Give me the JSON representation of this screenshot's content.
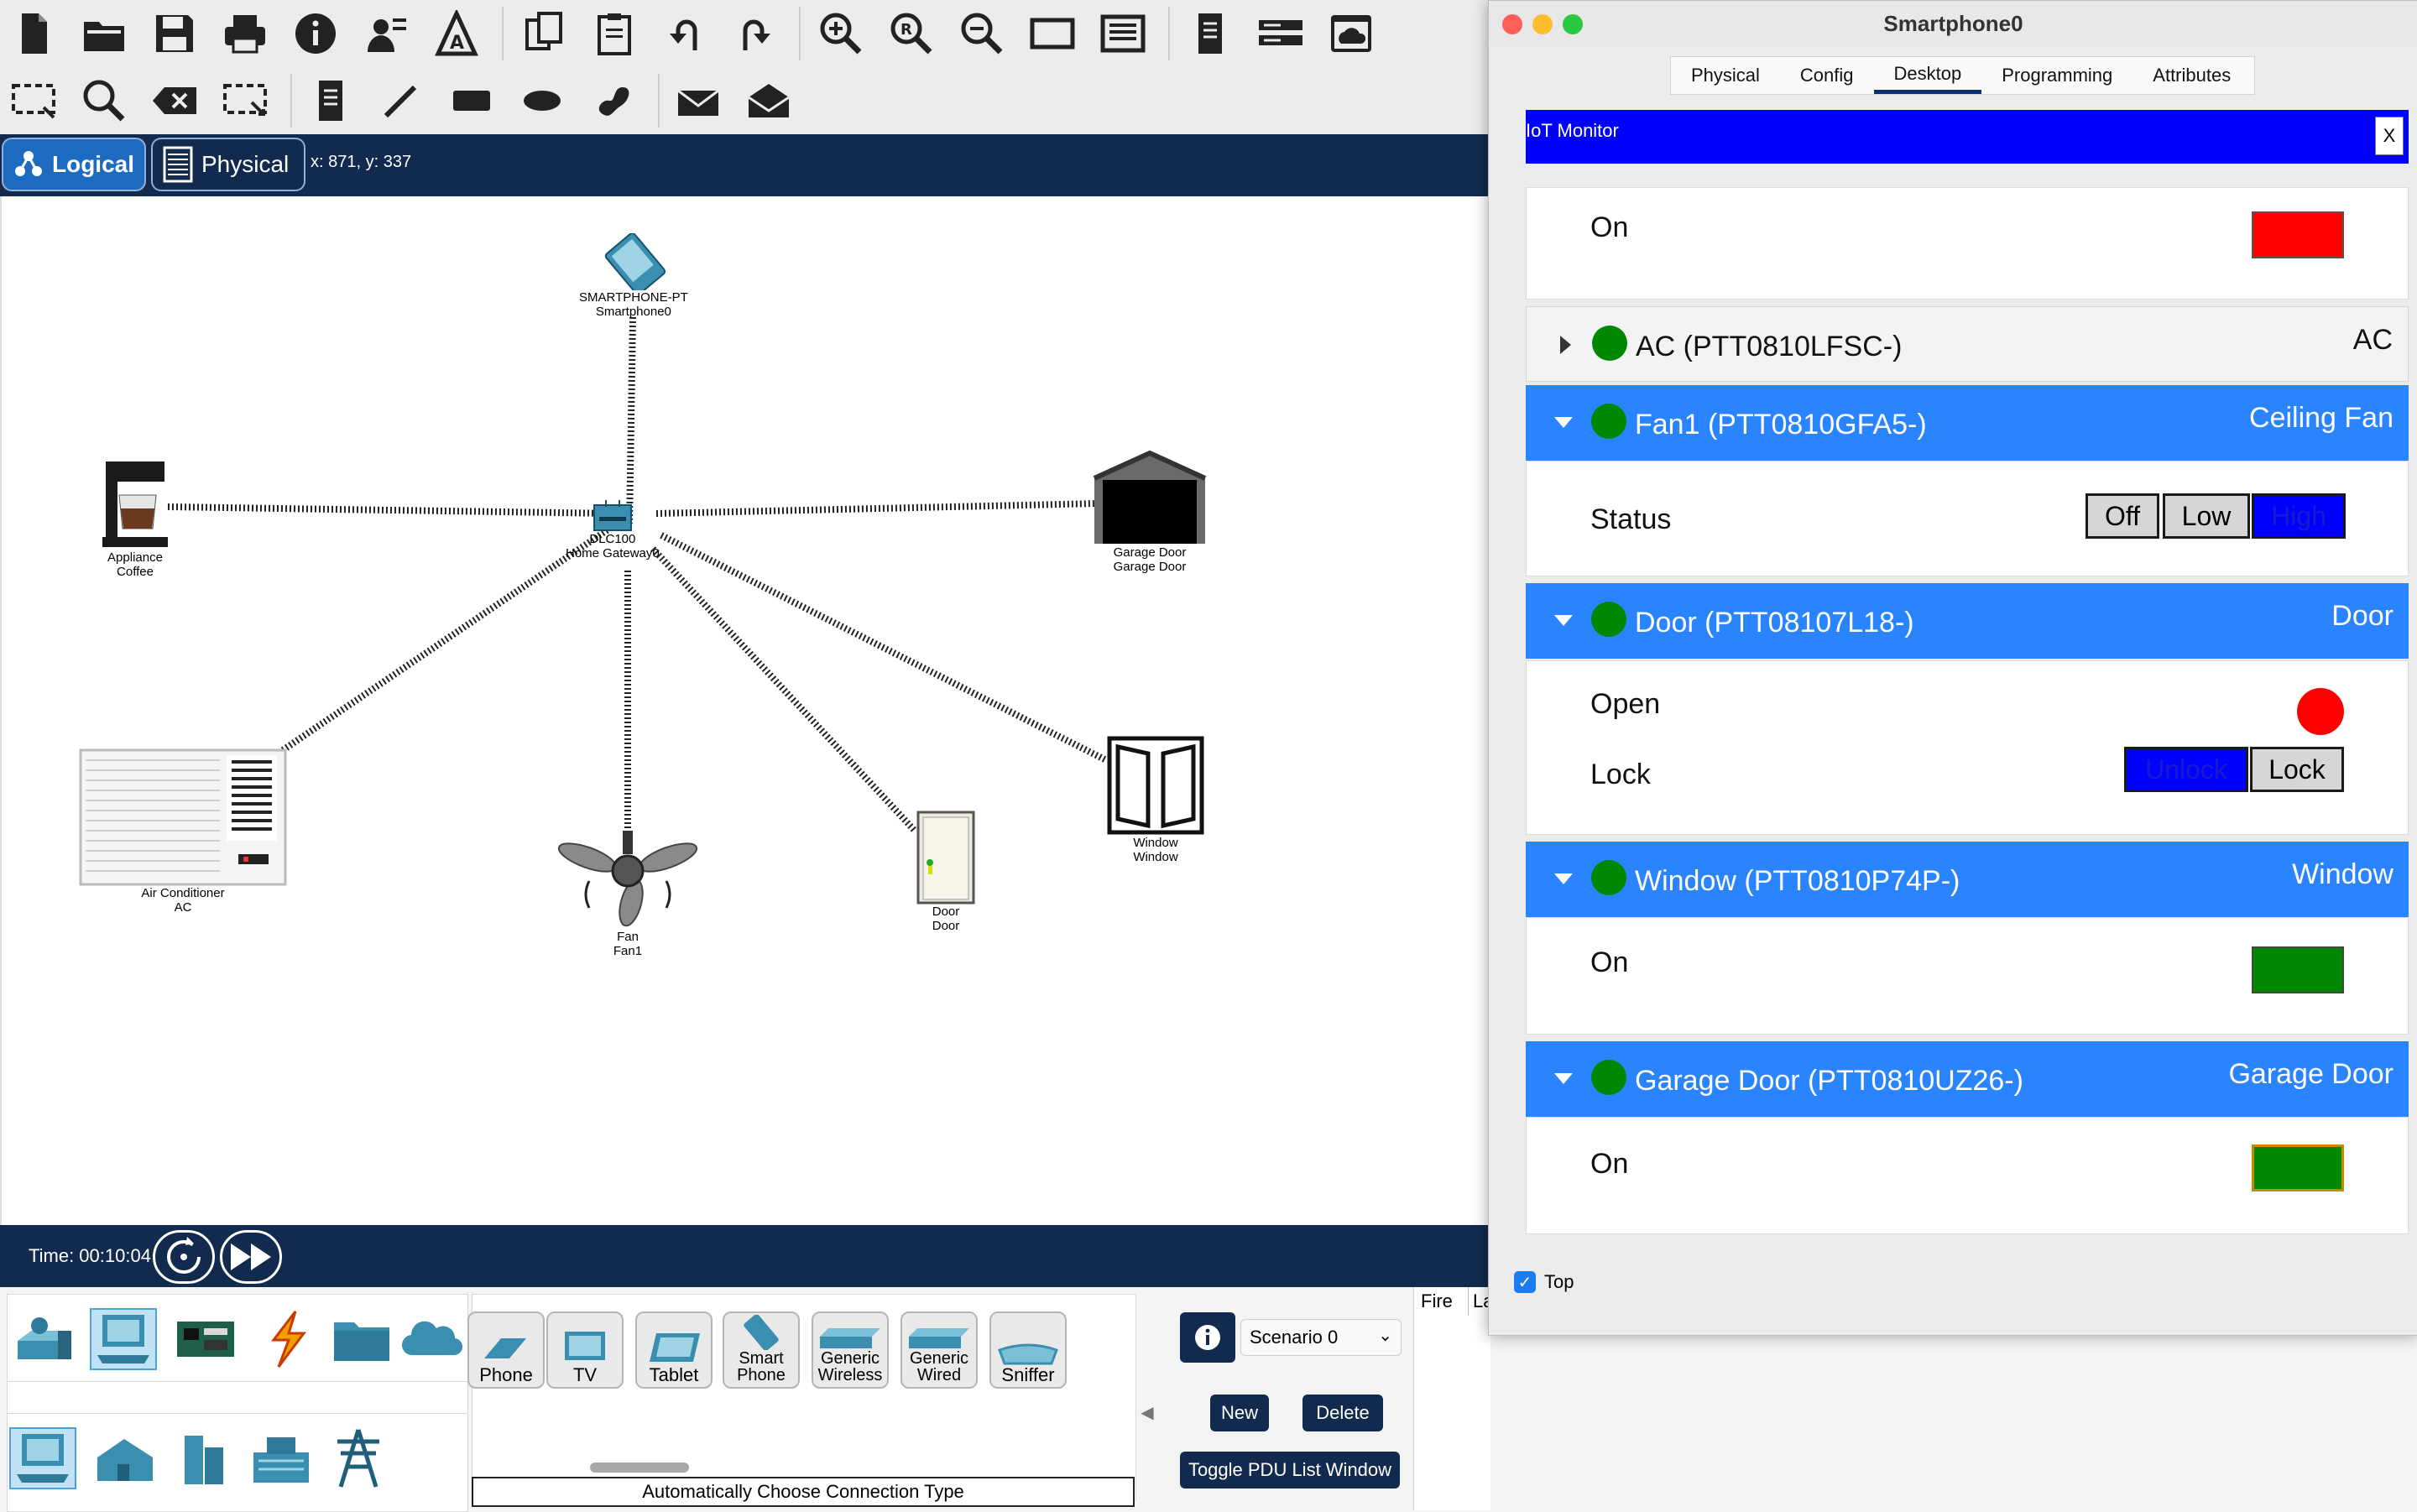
{
  "main": {
    "modes": {
      "logical": "Logical",
      "physical": "Physical"
    },
    "coords": "x: 871, y: 337",
    "time": "Time: 00:10:04",
    "devices": {
      "smartphone": {
        "line1": "SMARTPHONE-PT",
        "line2": "Smartphone0"
      },
      "gateway": {
        "line1": "DLC100",
        "line2": "Home Gateway0"
      },
      "coffee": {
        "line1": "Appliance",
        "line2": "Coffee"
      },
      "garage": {
        "line1": "Garage Door",
        "line2": "Garage Door"
      },
      "ac": {
        "line1": "Air Conditioner",
        "line2": "AC"
      },
      "fan": {
        "line1": "Fan",
        "line2": "Fan1"
      },
      "door": {
        "line1": "Door",
        "line2": "Door"
      },
      "window": {
        "line1": "Window",
        "line2": "Window"
      }
    },
    "device_tiles": [
      "Phone",
      "TV",
      "Tablet",
      "Smart Phone",
      "Generic Wireless",
      "Generic Wired",
      "Sniffer"
    ],
    "connection_type": "Automatically Choose Connection Type",
    "scenario": {
      "selected": "Scenario 0",
      "new_label": "New",
      "delete_label": "Delete",
      "toggle_label": "Toggle PDU List Window"
    },
    "pdu_columns": [
      "Fire",
      "La"
    ]
  },
  "window": {
    "title": "Smartphone0",
    "tabs": [
      "Physical",
      "Config",
      "Desktop",
      "Programming",
      "Attributes"
    ],
    "active_tab": "Desktop",
    "iot_title": "IoT Monitor",
    "close_label": "X",
    "top_on": {
      "label": "On",
      "color": "#ff0000"
    },
    "devices": [
      {
        "name": "AC (PTT0810LFSC-)",
        "type": "AC",
        "expanded": false
      },
      {
        "name": "Fan1 (PTT0810GFA5-)",
        "type": "Ceiling Fan",
        "expanded": true,
        "status_label": "Status",
        "options": [
          "Off",
          "Low",
          "High"
        ],
        "selected": "High"
      },
      {
        "name": "Door (PTT08107L18-)",
        "type": "Door",
        "expanded": true,
        "open_label": "Open",
        "open_color": "#ff0000",
        "lock_label": "Lock",
        "lock_options": [
          "Unlock",
          "Lock"
        ],
        "lock_selected": "Unlock"
      },
      {
        "name": "Window (PTT0810P74P-)",
        "type": "Window",
        "expanded": true,
        "on_label": "On",
        "color": "#008800"
      },
      {
        "name": "Garage Door (PTT0810UZ26-)",
        "type": "Garage Door",
        "expanded": true,
        "on_label": "On",
        "color": "#008800"
      }
    ],
    "top_checkbox": "Top"
  },
  "colors": {
    "nav_dark": "#122a4e",
    "iot_blue": "#0000ff",
    "header_blue": "#2a84ff",
    "status_green": "#008800",
    "status_red": "#ff0000"
  }
}
